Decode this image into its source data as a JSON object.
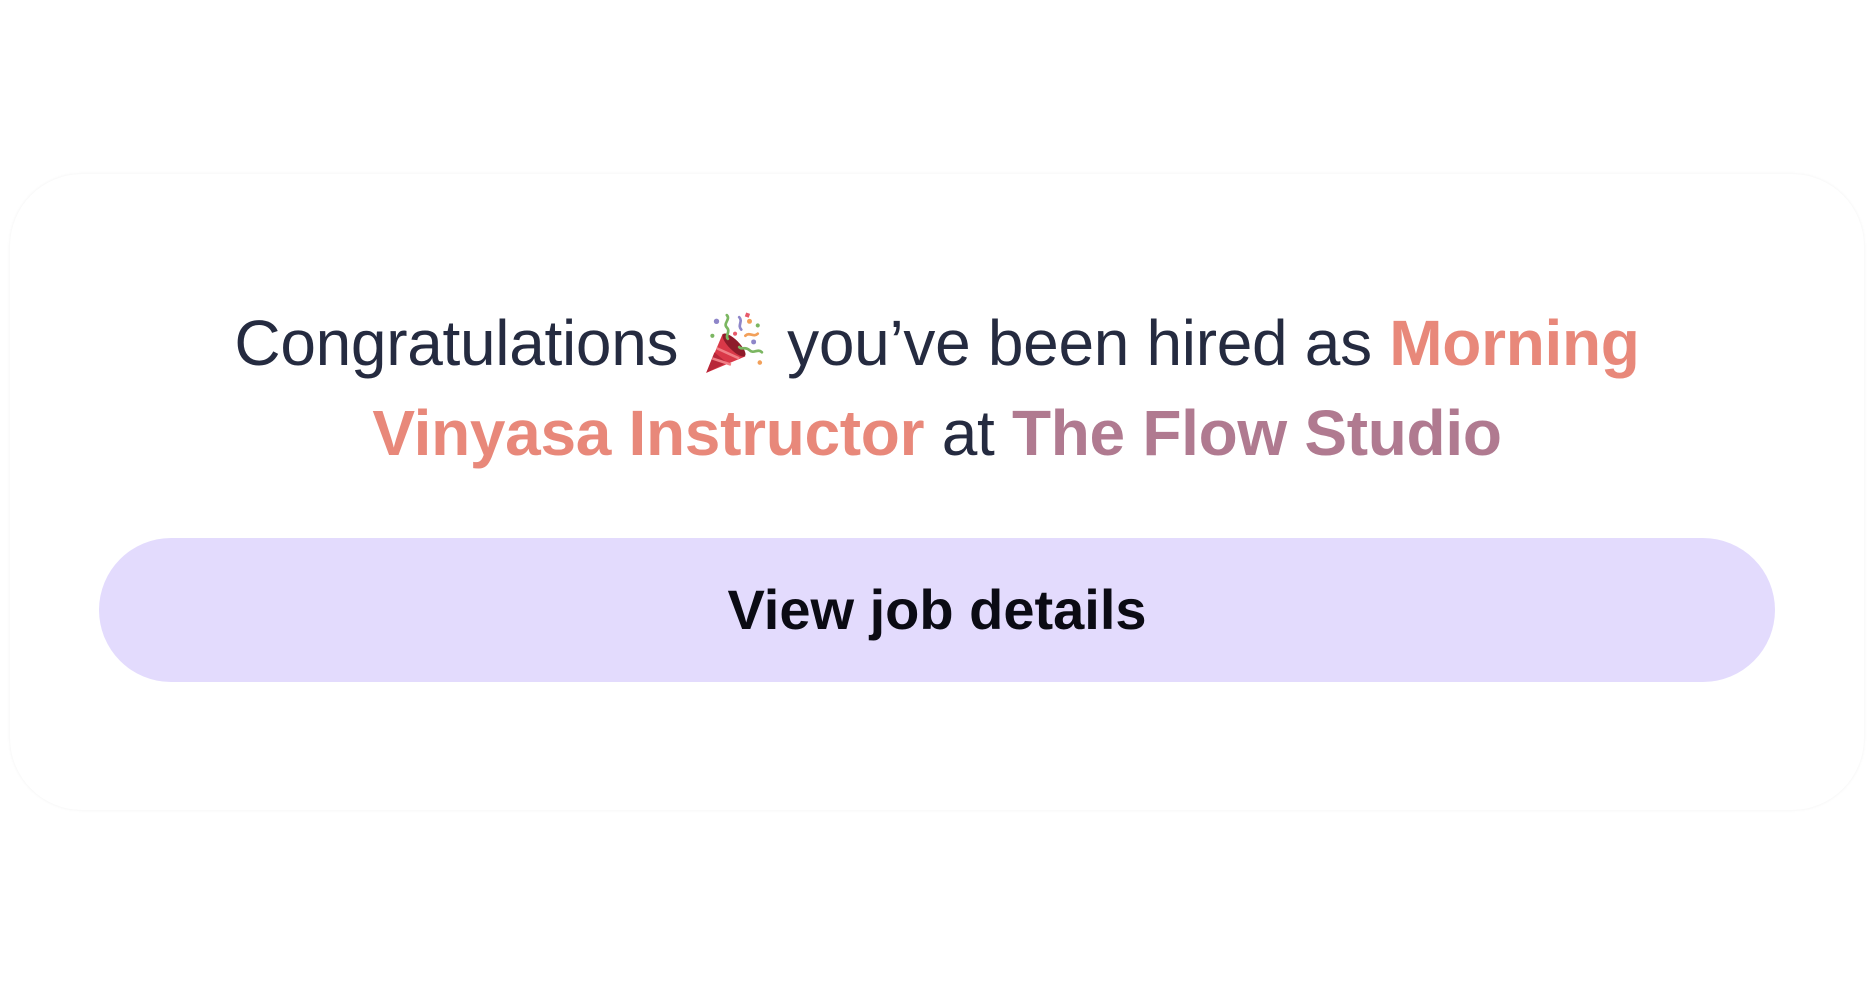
{
  "notification": {
    "prefix": "Congratulations",
    "icon": "party-popper-icon",
    "middle": "you’ve been hired as",
    "role": "Morning Vinyasa Instructor",
    "connector": "at",
    "company": "The Flow Studio"
  },
  "cta": {
    "label": "View job details"
  },
  "colors": {
    "text": "#252b40",
    "role": "#e8887a",
    "company": "#b07a90",
    "button_bg": "#e3dbfd",
    "button_text": "#0b0b14"
  }
}
